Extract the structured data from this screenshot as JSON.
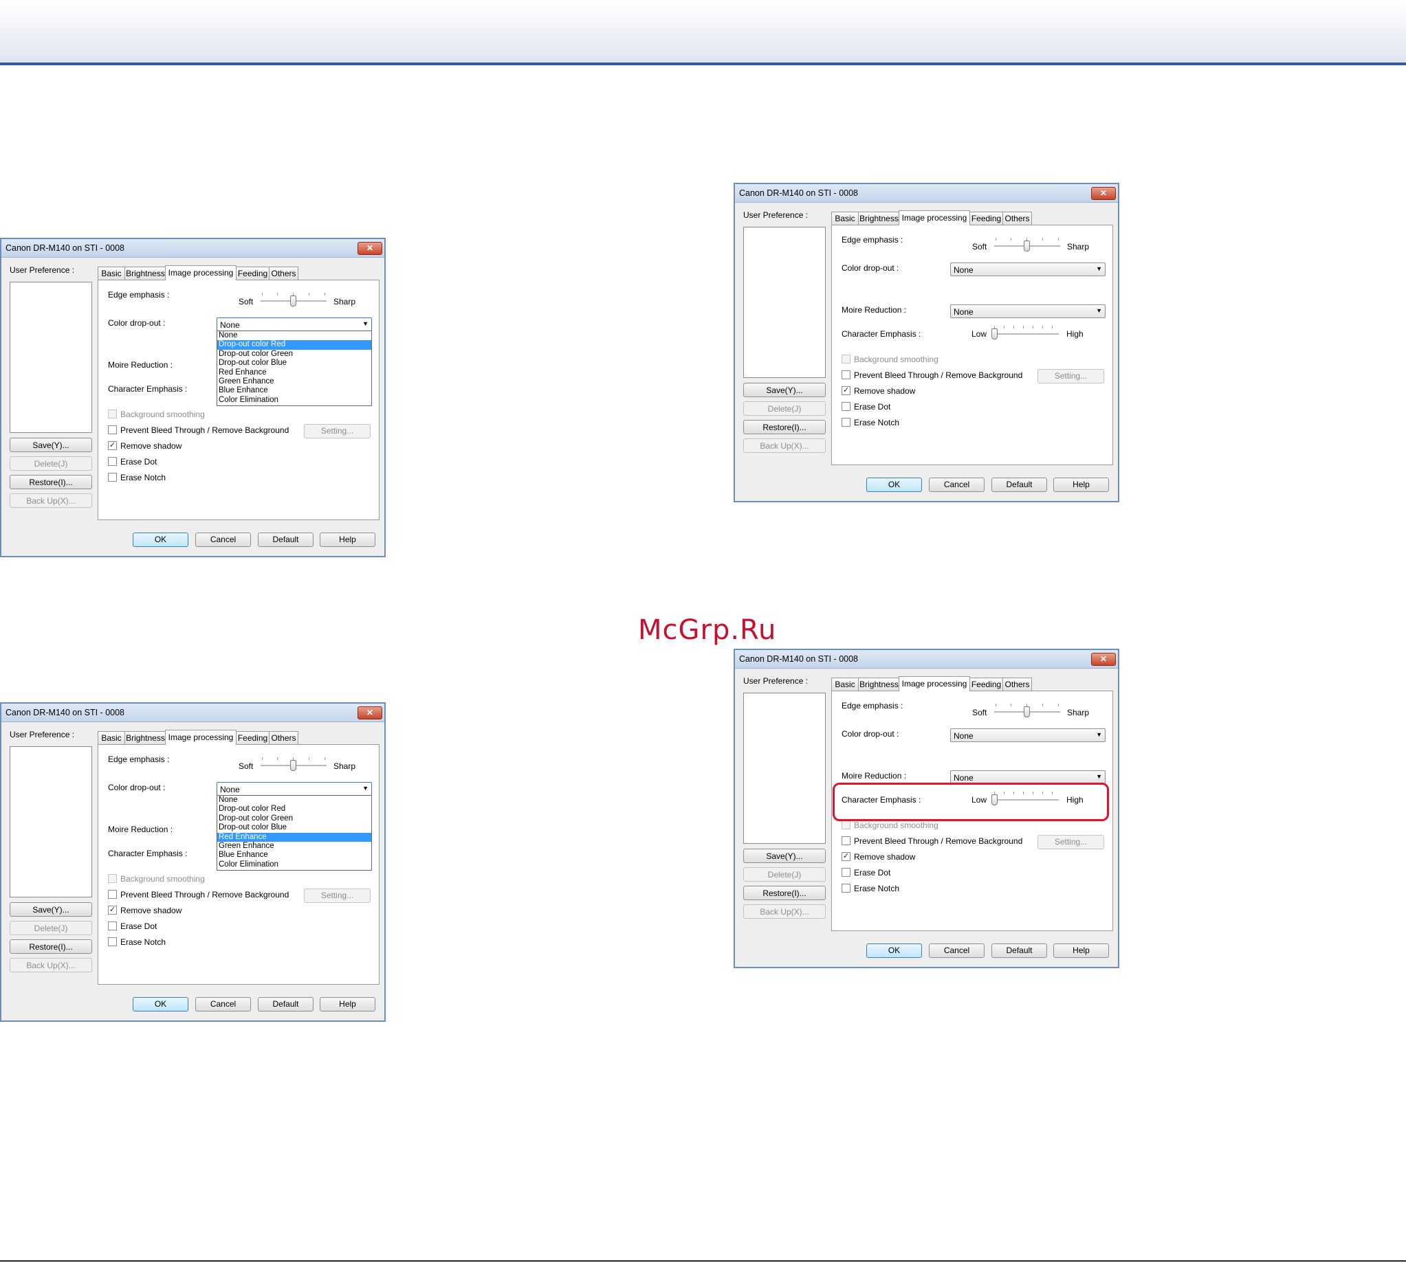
{
  "watermark": "McGrp.Ru",
  "dialog": {
    "title": "Canon DR-M140 on STI - 0008",
    "close_glyph": "✕",
    "user_preference_label": "User Preference :",
    "buttons": {
      "save": "Save(Y)...",
      "delete": "Delete(J)",
      "restore": "Restore(I)...",
      "backup": "Back Up(X)..."
    },
    "tabs": [
      "Basic",
      "Brightness",
      "Image processing",
      "Feeding",
      "Others"
    ],
    "edge_emphasis_label": "Edge emphasis :",
    "soft_label": "Soft",
    "sharp_label": "Sharp",
    "color_dropout_label": "Color drop-out :",
    "color_dropout_value": "None",
    "moire_label": "Moire Reduction :",
    "moire_value": "None",
    "char_emphasis_label": "Character Emphasis :",
    "low_label": "Low",
    "high_label": "High",
    "checkboxes": {
      "background_smoothing": "Background smoothing",
      "prevent_bleed": "Prevent Bleed Through / Remove Background",
      "remove_shadow": "Remove shadow",
      "erase_dot": "Erase Dot",
      "erase_notch": "Erase Notch"
    },
    "check_glyph": "✓",
    "setting_button": "Setting...",
    "bottom_buttons": {
      "ok": "OK",
      "cancel": "Cancel",
      "default": "Default",
      "help": "Help"
    },
    "dropdown_options": [
      "None",
      "Drop-out color Red",
      "Drop-out color Green",
      "Drop-out color Blue",
      "Red Enhance",
      "Green Enhance",
      "Blue Enhance",
      "Color Elimination"
    ],
    "dropdown_arrow": "▼"
  },
  "screens": [
    {
      "id": "red-dropout-open",
      "dropdown_open": true,
      "selected_option": "Drop-out color Red"
    },
    {
      "id": "red-enhance-open",
      "dropdown_open": true,
      "selected_option": "Red Enhance"
    },
    {
      "id": "dropout-closed",
      "dropdown_open": false
    },
    {
      "id": "char-emphasis-highlighted",
      "dropdown_open": false,
      "highlight": "Character Emphasis"
    }
  ],
  "colors": {
    "accent_rule": "#2e5aa8",
    "highlight_ring": "#e8112d",
    "selection": "#3399ff"
  }
}
